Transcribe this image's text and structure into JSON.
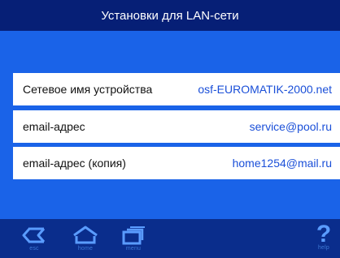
{
  "title": "Установки для LAN-сети",
  "rows": [
    {
      "label": "Сетевое имя устройства",
      "value": "osf-EUROMATIK-2000.net"
    },
    {
      "label": "email-адрес",
      "value": "service@pool.ru"
    },
    {
      "label": "email-адрес (копия)",
      "value": "home1254@mail.ru"
    }
  ],
  "nav": {
    "esc": "esc",
    "home": "home",
    "menu": "menu",
    "help_symbol": "?",
    "help": "help"
  },
  "colors": {
    "title_bg": "#061f76",
    "content_bg": "#1a63e8",
    "row_bg": "#ffffff",
    "value_text": "#1a4fd8",
    "bottom_bg": "#0a2d8c",
    "icon": "#5a9cff"
  },
  "icons": [
    "back-arrow-icon",
    "home-icon",
    "menu-icon",
    "help-icon"
  ]
}
